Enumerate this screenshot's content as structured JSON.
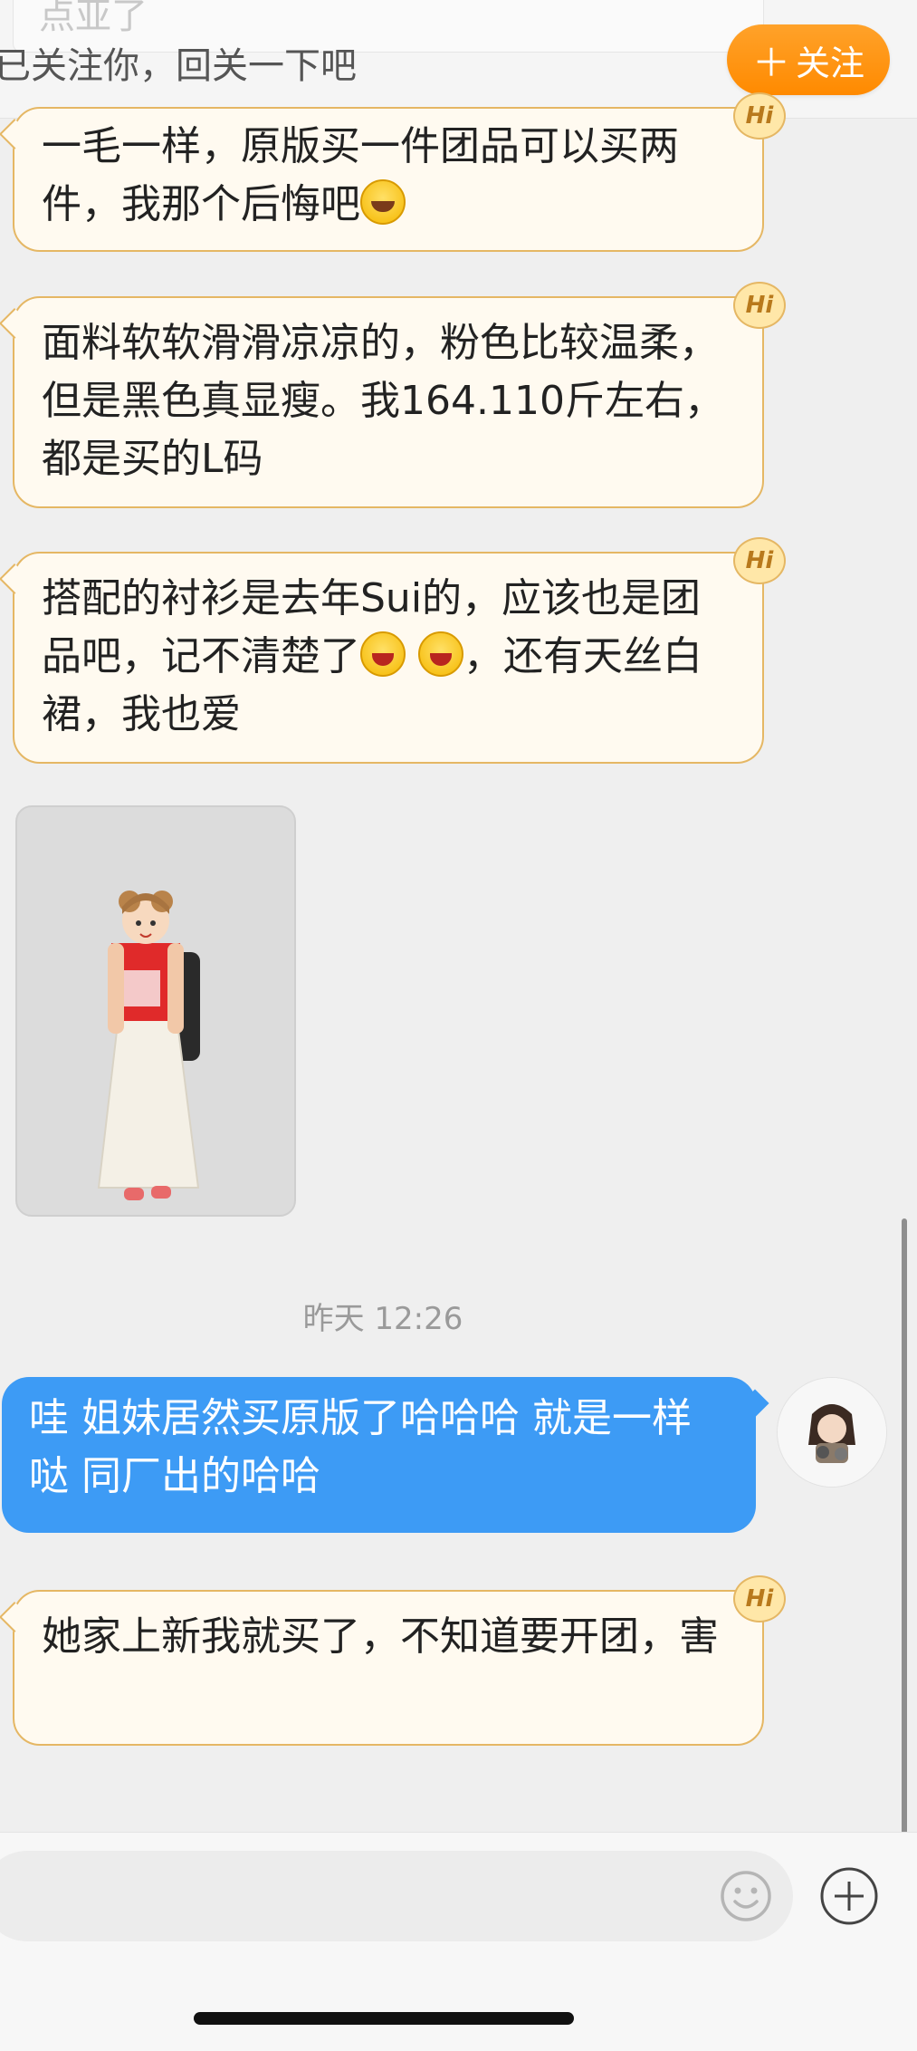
{
  "banner": {
    "peek_text": "点亚了",
    "text": "已关注你，回关一下吧",
    "follow_plus": "＋",
    "follow_label": "关注"
  },
  "messages": [
    {
      "badge": "Hi",
      "text_a": "一毛一样，原版买一件团品可以买两件，我那个后悔吧",
      "emoji": "laugh-with-tears-emoji"
    },
    {
      "badge": "Hi",
      "text": "面料软软滑滑凉凉的，粉色比较温柔，但是黑色真显瘦。我164.110斤左右，都是买的L码"
    },
    {
      "badge": "Hi",
      "text_a": "搭配的衬衫是去年Sui的，应该也是团品吧，记不清楚了",
      "text_b": "，还有天丝白裙，我也爱",
      "emoji": "grin-emoji"
    },
    {
      "badge": "Hi",
      "text": "她家上新我就买了，不知道要开团，害"
    }
  ],
  "timestamp": "昨天 12:26",
  "outgoing": {
    "text": "哇 姐妹居然买原版了哈哈哈 就是一样哒 同厂出的哈哈"
  },
  "input": {
    "placeholder": ""
  },
  "colors": {
    "accent": "#ff9a1a",
    "outgoing_bubble": "#3d9bf5",
    "incoming_border": "#e5b764",
    "incoming_bg": "#fffaf0"
  }
}
